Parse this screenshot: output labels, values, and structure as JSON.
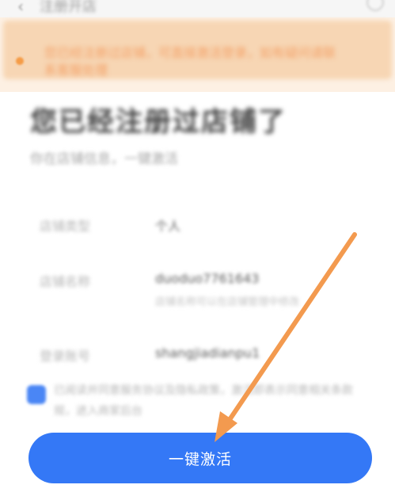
{
  "header": {
    "title": "注册开店",
    "back_icon": "‹"
  },
  "notice": {
    "text": "您已经注册过店铺，可直接激活登录，如有疑问请联系客服处理"
  },
  "heading": "您已经注册过店铺了",
  "subheading": "你在店铺信息，一键激活",
  "details": [
    {
      "label": "店铺类型",
      "value": "个人",
      "sub": ""
    },
    {
      "label": "店铺名称",
      "value": "duoduo7761643",
      "sub": "店铺名称可以在店铺管理中修改"
    },
    {
      "label": "登录账号",
      "value": "shangjiadianpu1",
      "sub": ""
    }
  ],
  "agreement": {
    "line1": "已阅读并同意服务协议及隐私政策，激活即表示同意相关条款",
    "line2": "规，进入商家后台"
  },
  "activate_button": {
    "label": "一键激活"
  },
  "accent_colors": {
    "button": "#3478f6",
    "arrow": "#f39a4f",
    "notice_bg": "#fdf0e3"
  }
}
